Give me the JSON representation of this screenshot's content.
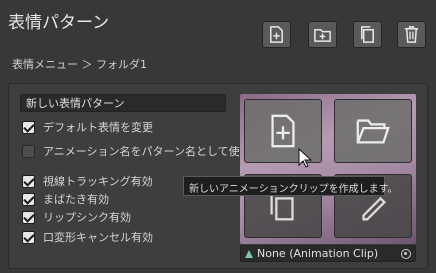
{
  "window": {
    "title": "表情パターン"
  },
  "toolbar": {
    "buttons": [
      {
        "icon": "add-file-icon"
      },
      {
        "icon": "add-folder-icon"
      },
      {
        "icon": "duplicate-icon"
      },
      {
        "icon": "trash-icon"
      }
    ]
  },
  "breadcrumb": {
    "text": "表情メニュー ＞ フォルダ1"
  },
  "pattern_name": {
    "value": "新しい表情パターン"
  },
  "options": [
    {
      "label": "デフォルト表情を変更",
      "checked": true
    },
    {
      "label": "アニメーション名をパターン名として使用",
      "checked": false
    },
    {
      "label": "視線トラッキング有効",
      "checked": true
    },
    {
      "label": "まばたき有効",
      "checked": true
    },
    {
      "label": "リップシンク有効",
      "checked": true
    },
    {
      "label": "口変形キャンセル有効",
      "checked": true
    }
  ],
  "preview": {
    "actions": [
      "new-clip",
      "open-folder",
      "duplicate",
      "edit"
    ],
    "tooltip": "新しいアニメーションクリップを作成します。"
  },
  "clip_field": {
    "value": "None (Animation Clip)"
  },
  "colors": {
    "background": "#383838",
    "panel": "#3e3e3e",
    "button": "#5a5a5a"
  }
}
